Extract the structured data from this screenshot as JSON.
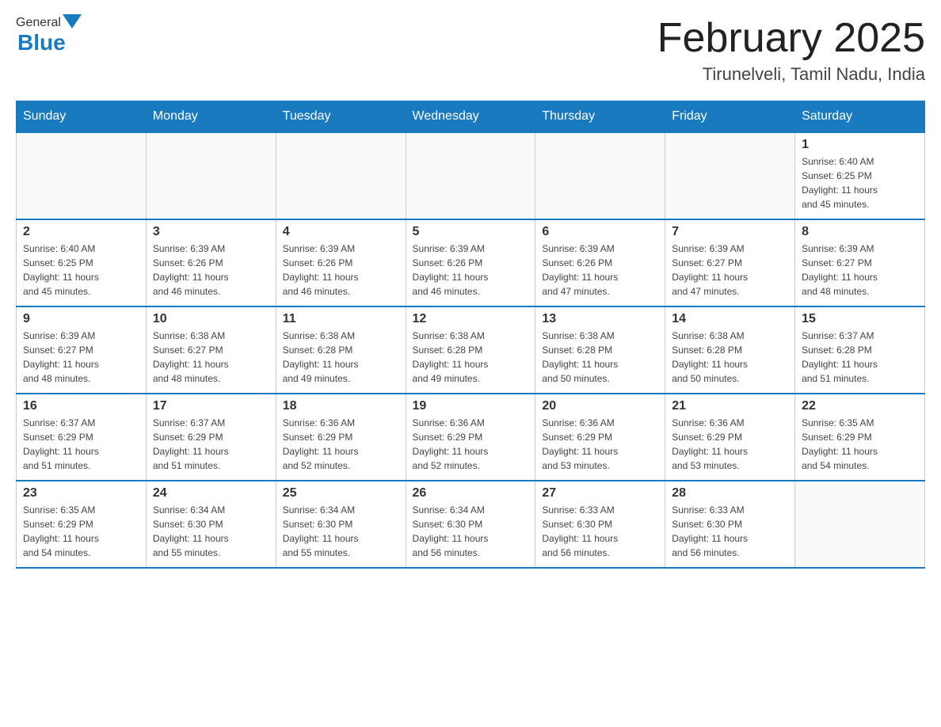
{
  "header": {
    "logo": {
      "general": "General",
      "blue": "Blue"
    },
    "title": "February 2025",
    "location": "Tirunelveli, Tamil Nadu, India"
  },
  "days_of_week": [
    "Sunday",
    "Monday",
    "Tuesday",
    "Wednesday",
    "Thursday",
    "Friday",
    "Saturday"
  ],
  "weeks": [
    {
      "days": [
        {
          "num": "",
          "info": ""
        },
        {
          "num": "",
          "info": ""
        },
        {
          "num": "",
          "info": ""
        },
        {
          "num": "",
          "info": ""
        },
        {
          "num": "",
          "info": ""
        },
        {
          "num": "",
          "info": ""
        },
        {
          "num": "1",
          "info": "Sunrise: 6:40 AM\nSunset: 6:25 PM\nDaylight: 11 hours\nand 45 minutes."
        }
      ]
    },
    {
      "days": [
        {
          "num": "2",
          "info": "Sunrise: 6:40 AM\nSunset: 6:25 PM\nDaylight: 11 hours\nand 45 minutes."
        },
        {
          "num": "3",
          "info": "Sunrise: 6:39 AM\nSunset: 6:26 PM\nDaylight: 11 hours\nand 46 minutes."
        },
        {
          "num": "4",
          "info": "Sunrise: 6:39 AM\nSunset: 6:26 PM\nDaylight: 11 hours\nand 46 minutes."
        },
        {
          "num": "5",
          "info": "Sunrise: 6:39 AM\nSunset: 6:26 PM\nDaylight: 11 hours\nand 46 minutes."
        },
        {
          "num": "6",
          "info": "Sunrise: 6:39 AM\nSunset: 6:26 PM\nDaylight: 11 hours\nand 47 minutes."
        },
        {
          "num": "7",
          "info": "Sunrise: 6:39 AM\nSunset: 6:27 PM\nDaylight: 11 hours\nand 47 minutes."
        },
        {
          "num": "8",
          "info": "Sunrise: 6:39 AM\nSunset: 6:27 PM\nDaylight: 11 hours\nand 48 minutes."
        }
      ]
    },
    {
      "days": [
        {
          "num": "9",
          "info": "Sunrise: 6:39 AM\nSunset: 6:27 PM\nDaylight: 11 hours\nand 48 minutes."
        },
        {
          "num": "10",
          "info": "Sunrise: 6:38 AM\nSunset: 6:27 PM\nDaylight: 11 hours\nand 48 minutes."
        },
        {
          "num": "11",
          "info": "Sunrise: 6:38 AM\nSunset: 6:28 PM\nDaylight: 11 hours\nand 49 minutes."
        },
        {
          "num": "12",
          "info": "Sunrise: 6:38 AM\nSunset: 6:28 PM\nDaylight: 11 hours\nand 49 minutes."
        },
        {
          "num": "13",
          "info": "Sunrise: 6:38 AM\nSunset: 6:28 PM\nDaylight: 11 hours\nand 50 minutes."
        },
        {
          "num": "14",
          "info": "Sunrise: 6:38 AM\nSunset: 6:28 PM\nDaylight: 11 hours\nand 50 minutes."
        },
        {
          "num": "15",
          "info": "Sunrise: 6:37 AM\nSunset: 6:28 PM\nDaylight: 11 hours\nand 51 minutes."
        }
      ]
    },
    {
      "days": [
        {
          "num": "16",
          "info": "Sunrise: 6:37 AM\nSunset: 6:29 PM\nDaylight: 11 hours\nand 51 minutes."
        },
        {
          "num": "17",
          "info": "Sunrise: 6:37 AM\nSunset: 6:29 PM\nDaylight: 11 hours\nand 51 minutes."
        },
        {
          "num": "18",
          "info": "Sunrise: 6:36 AM\nSunset: 6:29 PM\nDaylight: 11 hours\nand 52 minutes."
        },
        {
          "num": "19",
          "info": "Sunrise: 6:36 AM\nSunset: 6:29 PM\nDaylight: 11 hours\nand 52 minutes."
        },
        {
          "num": "20",
          "info": "Sunrise: 6:36 AM\nSunset: 6:29 PM\nDaylight: 11 hours\nand 53 minutes."
        },
        {
          "num": "21",
          "info": "Sunrise: 6:36 AM\nSunset: 6:29 PM\nDaylight: 11 hours\nand 53 minutes."
        },
        {
          "num": "22",
          "info": "Sunrise: 6:35 AM\nSunset: 6:29 PM\nDaylight: 11 hours\nand 54 minutes."
        }
      ]
    },
    {
      "days": [
        {
          "num": "23",
          "info": "Sunrise: 6:35 AM\nSunset: 6:29 PM\nDaylight: 11 hours\nand 54 minutes."
        },
        {
          "num": "24",
          "info": "Sunrise: 6:34 AM\nSunset: 6:30 PM\nDaylight: 11 hours\nand 55 minutes."
        },
        {
          "num": "25",
          "info": "Sunrise: 6:34 AM\nSunset: 6:30 PM\nDaylight: 11 hours\nand 55 minutes."
        },
        {
          "num": "26",
          "info": "Sunrise: 6:34 AM\nSunset: 6:30 PM\nDaylight: 11 hours\nand 56 minutes."
        },
        {
          "num": "27",
          "info": "Sunrise: 6:33 AM\nSunset: 6:30 PM\nDaylight: 11 hours\nand 56 minutes."
        },
        {
          "num": "28",
          "info": "Sunrise: 6:33 AM\nSunset: 6:30 PM\nDaylight: 11 hours\nand 56 minutes."
        },
        {
          "num": "",
          "info": ""
        }
      ]
    }
  ]
}
